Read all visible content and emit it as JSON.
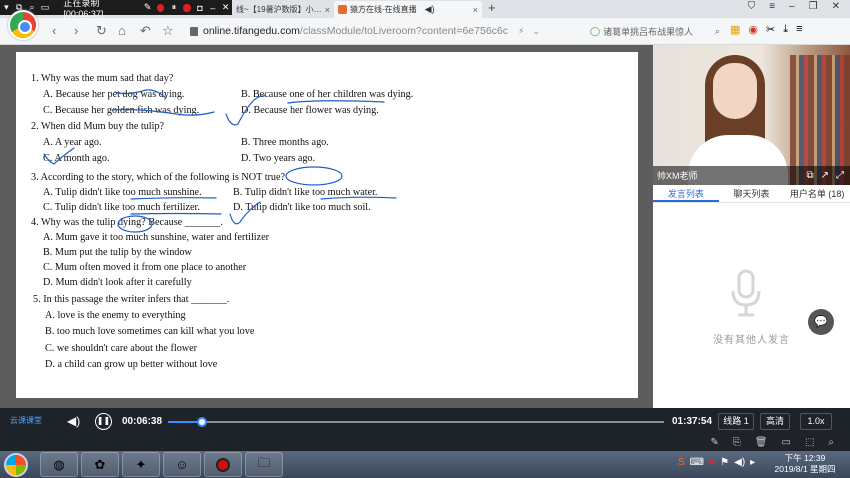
{
  "recorder": {
    "status": "正在录制 [00:06:37]"
  },
  "tabs": [
    {
      "label": "线~【19暑沪数版】小…",
      "close": "×"
    },
    {
      "label": "猿方在线-在线直播",
      "close": "×"
    }
  ],
  "new_tab": "+",
  "address": {
    "domain": "online.tifangedu.com",
    "path": "/classModule/toLiveroom?content=6e756c6c"
  },
  "search": {
    "placeholder": "诸葛单挑吕布战果惊人"
  },
  "quiz": {
    "q1": {
      "stem": "1. Why was the mum sad that day?",
      "a": "A. Because her pet dog was dying.",
      "b": "B. Because one of her children was dying.",
      "c": "C. Because her golden fish was dying.",
      "d": "D. Because her flower was dying."
    },
    "q2": {
      "stem": "2. When did Mum buy the tulip?",
      "a": "A. A year ago.",
      "b": "B. Three months ago.",
      "c": "C. A month ago.",
      "d": "D. Two years ago."
    },
    "q3": {
      "stem": "3. According to the story, which of the following is NOT true?",
      "a": "A. Tulip didn't like too much sunshine.",
      "b": "B. Tulip didn't like too much water.",
      "c": "C. Tulip didn't like too much fertilizer.",
      "d": "D. Tulip didn't like too much soil."
    },
    "q4": {
      "stem": "4. Why was the tulip dying? Because _______.",
      "a": "A. Mum gave it too much sunshine, water and fertilizer",
      "b": "B. Mum put the tulip by the window",
      "c": "C. Mum often moved it from one place to another",
      "d": "D. Mum didn't look after it carefully"
    },
    "q5": {
      "stem": "5. In this passage the writer infers that _______.",
      "a": "A. love is the enemy to everything",
      "b": "B. too much love sometimes can kill what you love",
      "c": "C. we shouldn't care about the flower",
      "d": "D. a child can grow up better without love"
    }
  },
  "teacher": {
    "name": "帅XM老师"
  },
  "side_tabs": [
    "发言列表",
    "聊天列表",
    "用户名单 (18)"
  ],
  "empty_message": "没有其他人发言",
  "player": {
    "logo": "云课课堂",
    "current_time": "00:06:38",
    "total_time": "01:37:54",
    "progress": 0.068,
    "line_label": "线路 1",
    "quality_label": "高清",
    "speed_label": "1.0x"
  },
  "clock": {
    "time": "下午 12:39",
    "date": "2019/8/1 星期四"
  },
  "colors": {
    "annotation": "#1f5fc4",
    "accent": "#2d6bd7",
    "player_bg": "#1e2229"
  }
}
